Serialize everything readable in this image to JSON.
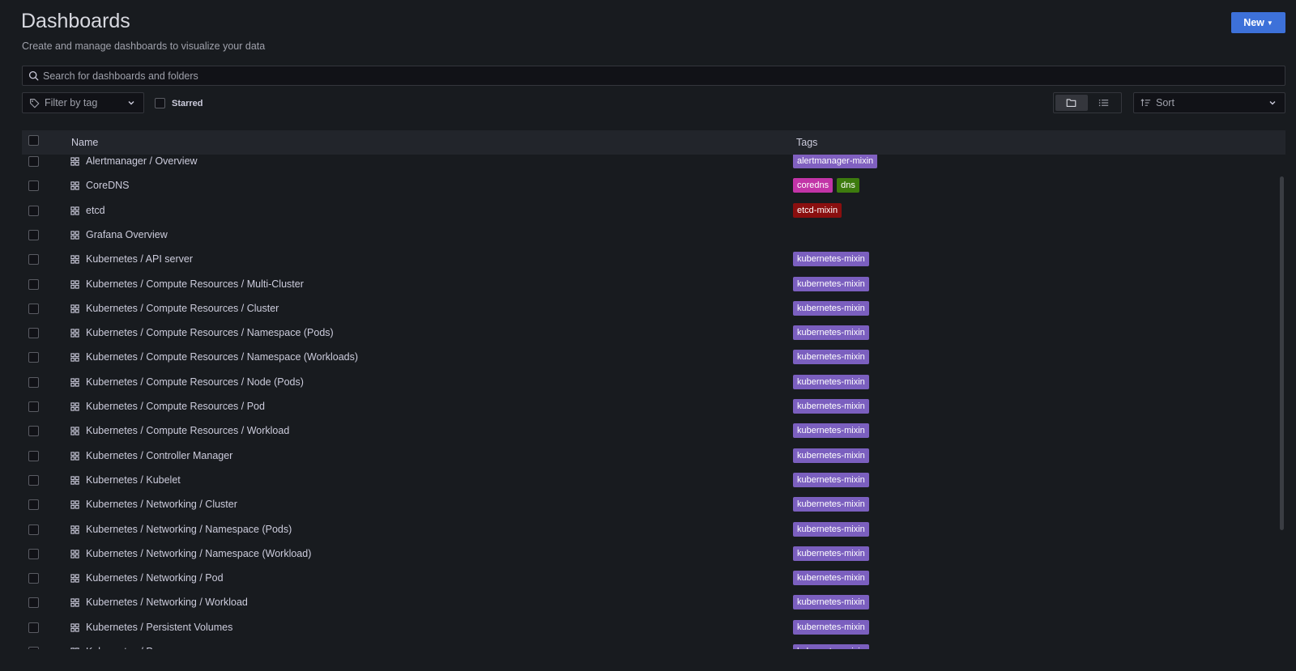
{
  "page": {
    "title": "Dashboards",
    "subtitle": "Create and manage dashboards to visualize your data"
  },
  "header": {
    "new_label": "New"
  },
  "search": {
    "placeholder": "Search for dashboards and folders"
  },
  "filters": {
    "tag_placeholder": "Filter by tag",
    "starred_label": "Starred",
    "sort_placeholder": "Sort",
    "view_modes": [
      "folder-view",
      "list-view"
    ],
    "active_view": "folder-view"
  },
  "table": {
    "columns": [
      "Name",
      "Tags"
    ],
    "rows": [
      {
        "title": "Alertmanager / Overview",
        "tags": [
          "alertmanager-mixin"
        ]
      },
      {
        "title": "CoreDNS",
        "tags": [
          "coredns",
          "dns"
        ]
      },
      {
        "title": "etcd",
        "tags": [
          "etcd-mixin"
        ]
      },
      {
        "title": "Grafana Overview",
        "tags": []
      },
      {
        "title": "Kubernetes / API server",
        "tags": [
          "kubernetes-mixin"
        ]
      },
      {
        "title": "Kubernetes / Compute Resources / Multi-Cluster",
        "tags": [
          "kubernetes-mixin"
        ]
      },
      {
        "title": "Kubernetes / Compute Resources / Cluster",
        "tags": [
          "kubernetes-mixin"
        ]
      },
      {
        "title": "Kubernetes / Compute Resources / Namespace (Pods)",
        "tags": [
          "kubernetes-mixin"
        ]
      },
      {
        "title": "Kubernetes / Compute Resources / Namespace (Workloads)",
        "tags": [
          "kubernetes-mixin"
        ]
      },
      {
        "title": "Kubernetes / Compute Resources / Node (Pods)",
        "tags": [
          "kubernetes-mixin"
        ]
      },
      {
        "title": "Kubernetes / Compute Resources / Pod",
        "tags": [
          "kubernetes-mixin"
        ]
      },
      {
        "title": "Kubernetes / Compute Resources / Workload",
        "tags": [
          "kubernetes-mixin"
        ]
      },
      {
        "title": "Kubernetes / Controller Manager",
        "tags": [
          "kubernetes-mixin"
        ]
      },
      {
        "title": "Kubernetes / Kubelet",
        "tags": [
          "kubernetes-mixin"
        ]
      },
      {
        "title": "Kubernetes / Networking / Cluster",
        "tags": [
          "kubernetes-mixin"
        ]
      },
      {
        "title": "Kubernetes / Networking / Namespace (Pods)",
        "tags": [
          "kubernetes-mixin"
        ]
      },
      {
        "title": "Kubernetes / Networking / Namespace (Workload)",
        "tags": [
          "kubernetes-mixin"
        ]
      },
      {
        "title": "Kubernetes / Networking / Pod",
        "tags": [
          "kubernetes-mixin"
        ]
      },
      {
        "title": "Kubernetes / Networking / Workload",
        "tags": [
          "kubernetes-mixin"
        ]
      },
      {
        "title": "Kubernetes / Persistent Volumes",
        "tags": [
          "kubernetes-mixin"
        ]
      },
      {
        "title": "Kubernetes / Proxy",
        "tags": [
          "kubernetes-mixin"
        ]
      }
    ]
  },
  "tag_colors": {
    "alertmanager-mixin": "#8060c0",
    "coredns": "#c234a7",
    "dns": "#3d7b0e",
    "etcd-mixin": "#8a0f0f",
    "kubernetes-mixin": "#7b5fbf"
  },
  "colors": {
    "accent": "#3d71d9",
    "background": "#181b1f"
  }
}
